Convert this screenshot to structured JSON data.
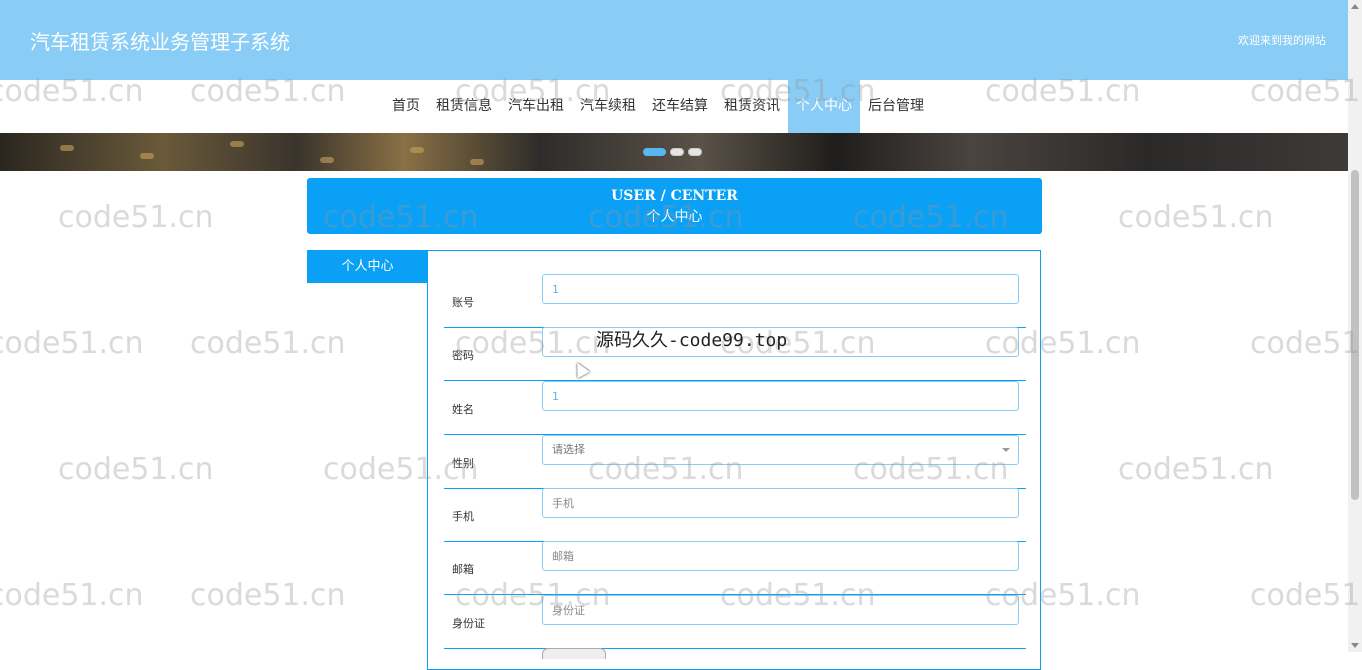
{
  "header": {
    "title": "汽车租赁系统业务管理子系统",
    "welcome": "欢迎来到我的网站"
  },
  "nav": {
    "items": [
      "首页",
      "租赁信息",
      "汽车出租",
      "汽车续租",
      "还车结算",
      "租赁资讯",
      "个人中心",
      "后台管理"
    ],
    "active": "个人中心"
  },
  "section": {
    "title_en": "USER / CENTER",
    "title_cn": "个人中心"
  },
  "sidebar": {
    "tab": "个人中心"
  },
  "form": {
    "account": {
      "label": "账号",
      "value": "1"
    },
    "password": {
      "label": "密码",
      "value": ""
    },
    "name": {
      "label": "姓名",
      "value": "1"
    },
    "gender": {
      "label": "性别",
      "value": "请选择"
    },
    "phone": {
      "label": "手机",
      "placeholder": "手机"
    },
    "email": {
      "label": "邮箱",
      "placeholder": "邮箱"
    },
    "id_card": {
      "label": "身份证",
      "placeholder": "身份证"
    }
  },
  "watermarks": {
    "site": "code51.cn",
    "overlay": "源码久久-code99.top"
  },
  "colors": {
    "header_bg": "#89cdf6",
    "accent": "#0aa0f5"
  }
}
